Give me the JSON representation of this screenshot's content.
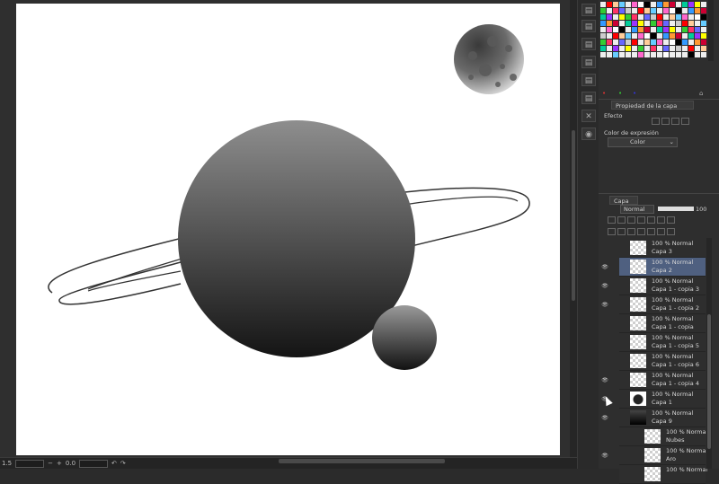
{
  "canvas": {
    "ring_color": "#333333",
    "planet_colors": [
      "#8e8e8e",
      "#141414"
    ]
  },
  "status_bar": {
    "zoom": "1.5",
    "rotation": "0.0"
  },
  "side_tools": [
    {
      "icon": "panel-icon"
    },
    {
      "icon": "panel-icon"
    },
    {
      "icon": "panel-icon"
    },
    {
      "icon": "panel-icon"
    },
    {
      "icon": "panel-icon"
    },
    {
      "icon": "panel-icon"
    },
    {
      "icon": "close-icon"
    },
    {
      "icon": "camera-icon"
    }
  ],
  "layer_property": {
    "tab_label": "Propiedad de la capa",
    "effect_label": "Efecto",
    "expression_color_label": "Color de expresión",
    "expression_color_value": "Color"
  },
  "layer_panel": {
    "tab_label": "Capa",
    "blend_mode": "Normal",
    "opacity": "100",
    "layers": [
      {
        "opacity_mode": "100 % Normal",
        "name": "Capa 3",
        "visible": false,
        "selected": false,
        "thumb": "blank",
        "indent": false
      },
      {
        "opacity_mode": "100 % Normal",
        "name": "Capa 2",
        "visible": true,
        "selected": true,
        "thumb": "blank",
        "indent": false
      },
      {
        "opacity_mode": "100 % Normal",
        "name": "Capa 1 - copia 3",
        "visible": true,
        "selected": false,
        "thumb": "blank",
        "indent": false
      },
      {
        "opacity_mode": "100 % Normal",
        "name": "Capa 1 - copia 2",
        "visible": true,
        "selected": false,
        "thumb": "blank",
        "indent": false
      },
      {
        "opacity_mode": "100 % Normal",
        "name": "Capa 1 - copia",
        "visible": false,
        "selected": false,
        "thumb": "dots",
        "indent": false
      },
      {
        "opacity_mode": "100 % Normal",
        "name": "Capa 1 - copia 5",
        "visible": false,
        "selected": false,
        "thumb": "blank",
        "indent": false
      },
      {
        "opacity_mode": "100 % Normal",
        "name": "Capa 1 - copia 6",
        "visible": false,
        "selected": false,
        "thumb": "blank",
        "indent": false
      },
      {
        "opacity_mode": "100 % Normal",
        "name": "Capa 1 - copia 4",
        "visible": true,
        "selected": false,
        "thumb": "blank",
        "indent": false
      },
      {
        "opacity_mode": "100 % Normal",
        "name": "Capa 1",
        "visible": true,
        "selected": false,
        "thumb": "planet",
        "indent": false
      },
      {
        "opacity_mode": "100 % Normal",
        "name": "Capa 9",
        "visible": true,
        "selected": false,
        "thumb": "gradient",
        "indent": false
      },
      {
        "opacity_mode": "100 % Normal",
        "name": "Nubes",
        "visible": false,
        "selected": false,
        "thumb": "blank",
        "indent": true
      },
      {
        "opacity_mode": "100 % Normal",
        "name": "Aro",
        "visible": true,
        "selected": false,
        "thumb": "blank",
        "indent": true
      },
      {
        "opacity_mode": "100 % Normal",
        "name": "",
        "visible": false,
        "selected": false,
        "thumb": "blank",
        "indent": true
      }
    ]
  }
}
